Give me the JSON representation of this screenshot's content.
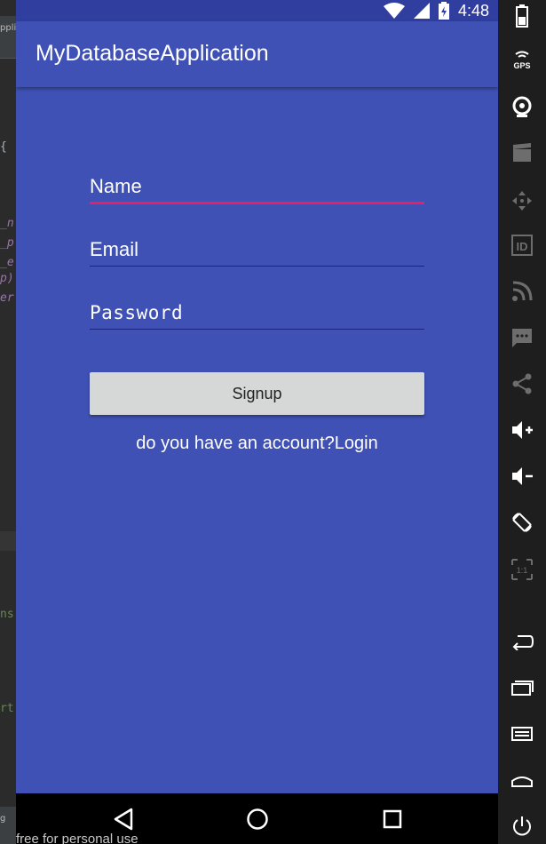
{
  "ide": {
    "tab_fragment": "pplic",
    "code_fragments": [
      "{",
      "_n",
      "_p",
      "_e",
      "p)",
      "er",
      "ns",
      "rt",
      "g"
    ],
    "footer_caption": "free for personal use"
  },
  "status_bar": {
    "time": "4:48",
    "icons": [
      "wifi-icon",
      "signal-icon",
      "battery-icon"
    ]
  },
  "app_bar": {
    "title": "MyDatabaseApplication"
  },
  "form": {
    "name_field": {
      "placeholder": "Name",
      "value": "",
      "focused": true
    },
    "email_field": {
      "placeholder": "Email",
      "value": ""
    },
    "password_field": {
      "placeholder": "Password",
      "value": ""
    },
    "signup_button": "Signup",
    "login_link": "do you have an account?Login"
  },
  "nav_bar": {
    "buttons": [
      "back-icon",
      "home-icon",
      "recents-icon"
    ]
  },
  "emulator_toolbar": {
    "items": [
      "battery-icon",
      "gps-icon",
      "camera-icon",
      "video-icon",
      "dpad-icon",
      "fingerprint-id-icon",
      "cellular-icon",
      "sms-icon",
      "share-icon",
      "volume-up-icon",
      "volume-down-icon",
      "rotate-icon",
      "zoom-icon",
      "back-icon",
      "recents-icon",
      "menu-icon",
      "home-icon",
      "power-icon"
    ],
    "gps_label": "GPS",
    "id_label": "ID",
    "zoom_label": "1:1"
  },
  "colors": {
    "primary": "#3f51b5",
    "primary_dark": "#303f9f",
    "accent": "#e91e63",
    "button": "#d6d7d7"
  }
}
